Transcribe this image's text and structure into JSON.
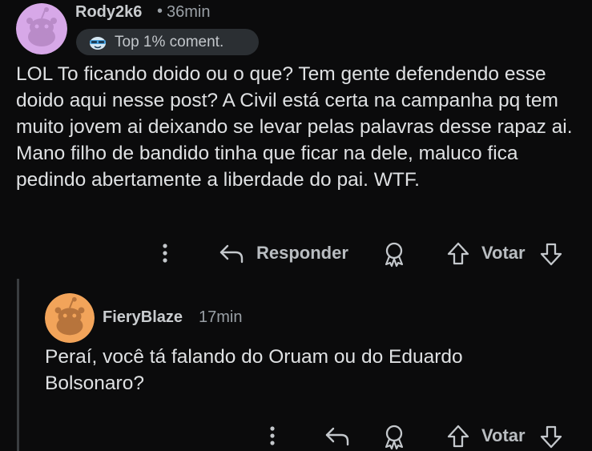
{
  "comment1": {
    "username": "Rody2k6",
    "separator": "•",
    "time": "36min",
    "badge_label": "Top 1% coment.",
    "body": "LOL To ficando doido ou o que? Tem gente defendendo esse doido aqui nesse post? A Civil está certa na campanha pq tem muito jovem ai deixando se levar pelas palavras desse rapaz ai. Mano filho de bandido tinha que ficar na dele, maluco fica pedindo abertamente a liberdade do pai. WTF.",
    "actions": {
      "reply_label": "Responder",
      "vote_label": "Votar"
    },
    "avatar_color": "#d7a8e8"
  },
  "comment2": {
    "username": "FieryBlaze",
    "time": "17min",
    "body": "Peraí, você tá falando do Oruam ou do Eduardo Bolsonaro?",
    "actions": {
      "vote_label": "Votar"
    },
    "avatar_color": "#f2a45a"
  },
  "icons": [
    "more-options-icon",
    "reply-icon",
    "award-icon",
    "upvote-icon",
    "downvote-icon",
    "top-commenter-badge-icon"
  ]
}
